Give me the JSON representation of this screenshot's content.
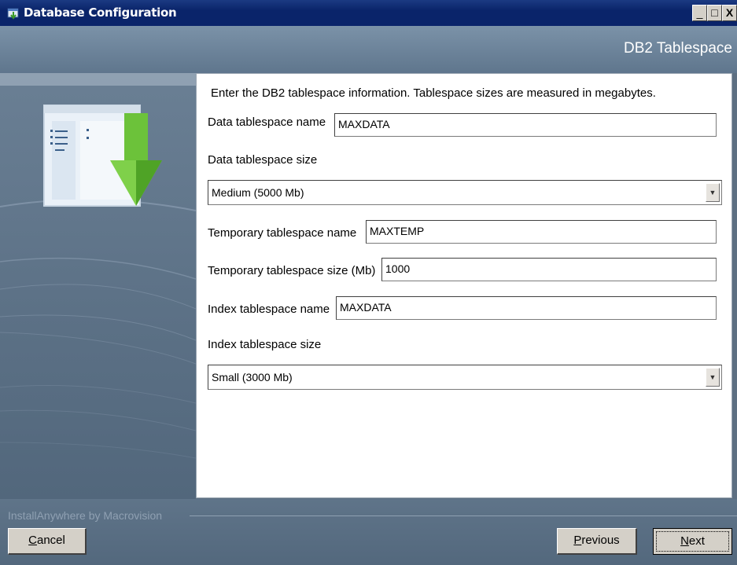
{
  "window": {
    "title": "Database Configuration",
    "controls": {
      "minimize": "_",
      "maximize": "□",
      "close": "X"
    }
  },
  "header": {
    "title": "DB2 Tablespace"
  },
  "content": {
    "intro": "Enter the DB2 tablespace information. Tablespace sizes are measured in megabytes.",
    "data_tablespace_name": {
      "label": "Data tablespace name",
      "value": "MAXDATA"
    },
    "data_tablespace_size": {
      "label": "Data tablespace size",
      "selected": "Medium (5000 Mb)"
    },
    "temp_tablespace_name": {
      "label": "Temporary tablespace name",
      "value": "MAXTEMP"
    },
    "temp_tablespace_size": {
      "label": "Temporary tablespace size (Mb)",
      "value": "1000"
    },
    "index_tablespace_name": {
      "label": "Index tablespace name",
      "value": "MAXDATA"
    },
    "index_tablespace_size": {
      "label": "Index tablespace size",
      "selected": "Small (3000 Mb)"
    }
  },
  "footer": {
    "brand": "InstallAnywhere by Macrovision",
    "cancel": {
      "mnemonic": "C",
      "rest": "ancel"
    },
    "previous": {
      "mnemonic": "P",
      "rest": "revious"
    },
    "next": {
      "mnemonic": "N",
      "rest": "ext"
    }
  },
  "icons": {
    "app": "installer-window-icon",
    "illustration": "download-arrow-window-illustration",
    "dropdown": "chevron-down-icon"
  }
}
